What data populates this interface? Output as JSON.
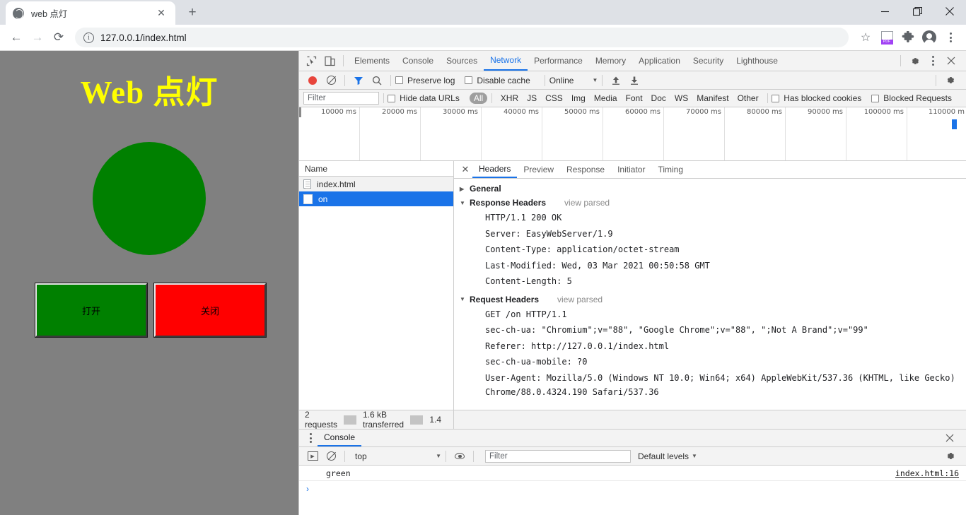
{
  "browser": {
    "tab": {
      "title": "web 点灯",
      "favicon": "globe-icon",
      "close": "✕"
    },
    "newtab_label": "+",
    "window": {
      "minimize": "—",
      "maximize": "❐",
      "close": "✕"
    },
    "nav": {
      "back": "←",
      "forward": "→",
      "reload": "⟳"
    },
    "omnibox": {
      "value": "127.0.0.1/index.html",
      "info": "ⓘ"
    },
    "actions": {
      "bookmark": "☆",
      "pdf": "PDF",
      "extensions": "puzzle-icon",
      "profile": "avatar-icon",
      "menu": "kebab-icon"
    }
  },
  "page": {
    "title": "Web 点灯",
    "title_color": "#ffff00",
    "background": "#808080",
    "lamp_color": "#008000",
    "buttons": [
      {
        "label": "打开",
        "color": "#008000"
      },
      {
        "label": "关闭",
        "color": "#ff0000"
      }
    ]
  },
  "devtools": {
    "panels": [
      "Elements",
      "Console",
      "Sources",
      "Network",
      "Performance",
      "Memory",
      "Application",
      "Security",
      "Lighthouse"
    ],
    "active_panel": "Network",
    "network_toolbar": {
      "record": "record-icon",
      "clear": "clear-icon",
      "filter": "funnel-icon",
      "search": "search-icon",
      "preserve_log": "Preserve log",
      "disable_cache": "Disable cache",
      "throttling": "Online",
      "import": "import-icon",
      "export": "export-icon"
    },
    "filter_bar": {
      "placeholder": "Filter",
      "hide_data_urls": "Hide data URLs",
      "types": [
        "All",
        "XHR",
        "JS",
        "CSS",
        "Img",
        "Media",
        "Font",
        "Doc",
        "WS",
        "Manifest",
        "Other"
      ],
      "selected_type": "All",
      "has_blocked_cookies": "Has blocked cookies",
      "blocked_requests": "Blocked Requests"
    },
    "overview_ticks": [
      "10000 ms",
      "20000 ms",
      "30000 ms",
      "40000 ms",
      "50000 ms",
      "60000 ms",
      "70000 ms",
      "80000 ms",
      "90000 ms",
      "100000 ms",
      "110000 m"
    ],
    "requests": {
      "column_header": "Name",
      "rows": [
        {
          "name": "index.html",
          "icon": "document-icon",
          "selected": false
        },
        {
          "name": "on",
          "icon": "blank-document-icon",
          "selected": true
        }
      ]
    },
    "detail": {
      "tabs": [
        "Headers",
        "Preview",
        "Response",
        "Initiator",
        "Timing"
      ],
      "active_tab": "Headers",
      "close": "✕",
      "sections": [
        {
          "name": "General",
          "expanded": false,
          "view_parsed": "",
          "lines": []
        },
        {
          "name": "Response Headers",
          "expanded": true,
          "view_parsed": "view parsed",
          "lines": [
            "HTTP/1.1 200 OK",
            "Server: EasyWebServer/1.9",
            "Content-Type: application/octet-stream",
            "Last-Modified: Wed, 03 Mar 2021 00:50:58 GMT",
            "Content-Length: 5"
          ]
        },
        {
          "name": "Request Headers",
          "expanded": true,
          "view_parsed": "view parsed",
          "lines": [
            "GET /on HTTP/1.1",
            "sec-ch-ua: \"Chromium\";v=\"88\", \"Google Chrome\";v=\"88\", \";Not A Brand\";v=\"99\"",
            "Referer: http://127.0.0.1/index.html",
            "sec-ch-ua-mobile: ?0",
            "User-Agent: Mozilla/5.0 (Windows NT 10.0; Win64; x64) AppleWebKit/537.36 (KHTML, like Gecko) Chrome/88.0.4324.190 Safari/537.36"
          ]
        }
      ]
    },
    "status_bar": {
      "requests": "2 requests",
      "transferred": "1.6 kB transferred",
      "resources": "1.4"
    },
    "drawer": {
      "tab": "Console",
      "toolbar": {
        "context": "top",
        "filter_placeholder": "Filter",
        "levels": "Default levels"
      },
      "messages": [
        {
          "text": "green",
          "source": "index.html:16"
        }
      ],
      "prompt": "›"
    },
    "settings_icon": "gear-icon",
    "more_icon": "kebab-icon",
    "close_icon": "close-icon",
    "inspect_icon": "inspect-icon",
    "device_icon": "device-toggle-icon"
  }
}
